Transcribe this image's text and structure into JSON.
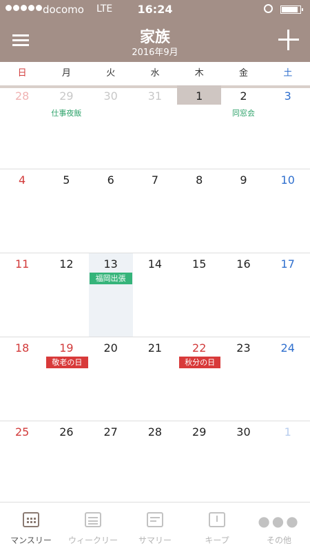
{
  "status": {
    "carrier": "docomo",
    "network": "LTE",
    "time": "16:24"
  },
  "nav": {
    "title": "家族",
    "subtitle": "2016年9月"
  },
  "weekdays": [
    "日",
    "月",
    "火",
    "水",
    "木",
    "金",
    "土"
  ],
  "weeks": [
    [
      "28",
      "29",
      "30",
      "31",
      "1",
      "2",
      "3"
    ],
    [
      "4",
      "5",
      "6",
      "7",
      "8",
      "9",
      "10"
    ],
    [
      "11",
      "12",
      "13",
      "14",
      "15",
      "16",
      "17"
    ],
    [
      "18",
      "19",
      "20",
      "21",
      "22",
      "23",
      "24"
    ],
    [
      "25",
      "26",
      "27",
      "28",
      "29",
      "30",
      "1"
    ]
  ],
  "events": {
    "shigoto": "仕事夜飯",
    "dousoukai": "同窓会",
    "fukuoka": "福岡出張",
    "keirou": "敬老の日",
    "shubun": "秋分の日"
  },
  "tabs": [
    "マンスリー",
    "ウィークリー",
    "サマリー",
    "キープ",
    "その他"
  ],
  "colors": {
    "header": "#a38f87",
    "sunday": "#d23a3a",
    "saturday": "#2f6fce",
    "event_green": "#35b47a",
    "holiday_red": "#d83a3a"
  }
}
